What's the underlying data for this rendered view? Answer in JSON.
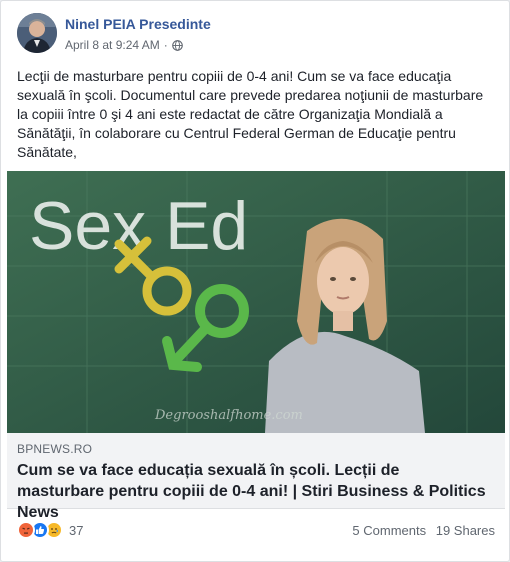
{
  "post": {
    "author": "Ninel PEIA Presedinte",
    "timestamp": "April 8 at 9:24 AM",
    "separator": "·",
    "privacy_icon": "globe-icon",
    "text": "Lecţii de masturbare pentru copiii de 0-4 ani! Cum se va face educaţia sexuală în şcoli. Documentul care prevede predarea noţiunii de masturbare la copiii între 0 şi 4 ani este redactat de către Organizaţia Mondială a Sănătăţii, în colaborare cu Centrul Federal German de Educaţie pentru Sănătate,"
  },
  "image": {
    "board_text": "Sex Ed",
    "watermark": "Degrooshalfhome.com"
  },
  "link_preview": {
    "domain": "BPNEWS.RO",
    "title": "Cum se va face educația sexuală în școli. Lecții de masturbare pentru copiii de 0-4 ani! | Stiri Business & Politics News"
  },
  "footer": {
    "reaction_icons": [
      "angry-reaction-icon",
      "like-reaction-icon",
      "sad-reaction-icon"
    ],
    "reaction_count": "37",
    "comments": "5 Comments",
    "shares": "19 Shares"
  },
  "colors": {
    "author_link": "#365899",
    "like_blue": "#1877f2",
    "angry_orange": "#f0643a",
    "sad_yellow": "#f7b928",
    "chalkboard": "#2f5a43"
  }
}
